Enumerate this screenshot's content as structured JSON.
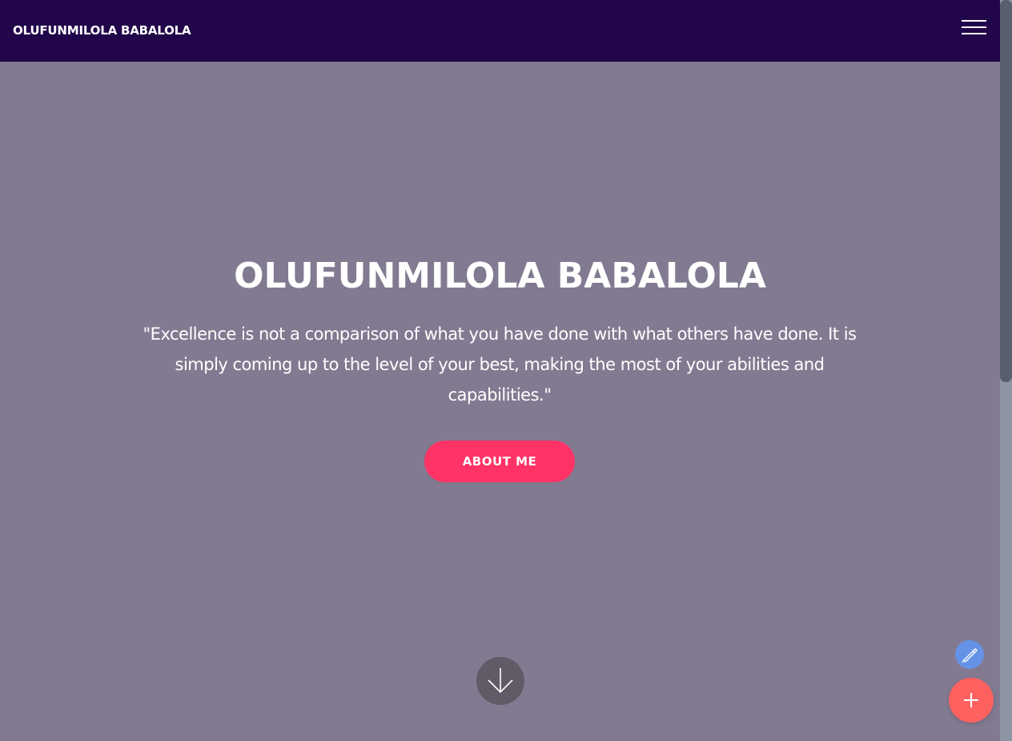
{
  "navbar": {
    "brand": "OLUFUNMILOLA BABALOLA",
    "menu_icon": "hamburger-menu-icon",
    "background_color": "#22064b"
  },
  "hero": {
    "title": "OLUFUNMILOLA BABALOLA",
    "quote": "\"Excellence is not a comparison of what you have done with what others have done. It is simply coming up to the level of your best, making the most of your abilities and capabilities.\"",
    "button_label": "ABOUT ME",
    "button_color": "#ff3366",
    "scroll_icon": "arrow-down-icon",
    "background_color": "#827a91"
  },
  "fabs": {
    "edit_icon": "pen-icon",
    "edit_color": "#6592e6",
    "add_icon": "plus-icon",
    "add_color": "#ff6160"
  }
}
